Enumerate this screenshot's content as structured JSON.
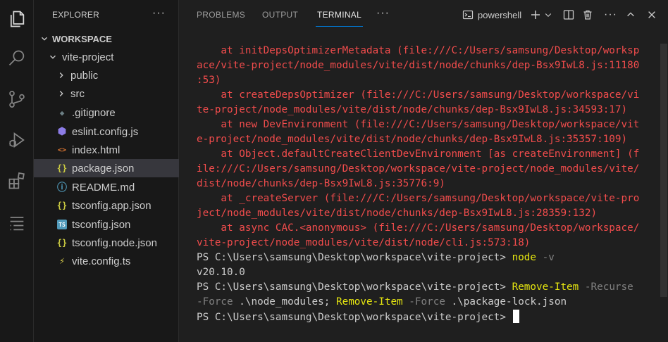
{
  "sidebar": {
    "title": "EXPLORER",
    "more": "···",
    "workspace": "WORKSPACE",
    "items": [
      {
        "label": "vite-project",
        "kind": "folder-open",
        "icon": "chevron-down-icon"
      },
      {
        "label": "public",
        "kind": "folder",
        "icon": "chevron-right-icon"
      },
      {
        "label": "src",
        "kind": "folder",
        "icon": "chevron-right-icon"
      },
      {
        "label": ".gitignore",
        "kind": "file",
        "icon": "gitignore-icon",
        "glyph": "◆",
        "color": "#6d8086"
      },
      {
        "label": "eslint.config.js",
        "kind": "file",
        "icon": "eslint-icon",
        "glyph": "⬢",
        "color": "#8c7ce6"
      },
      {
        "label": "index.html",
        "kind": "file",
        "icon": "html-icon",
        "glyph": "<>",
        "color": "#e37933"
      },
      {
        "label": "package.json",
        "kind": "file",
        "icon": "json-icon",
        "glyph": "{}",
        "color": "#cbcb41",
        "selected": true
      },
      {
        "label": "README.md",
        "kind": "file",
        "icon": "info-icon",
        "glyph": "ⓘ",
        "color": "#519aba"
      },
      {
        "label": "tsconfig.app.json",
        "kind": "file",
        "icon": "json-icon",
        "glyph": "{}",
        "color": "#cbcb41"
      },
      {
        "label": "tsconfig.json",
        "kind": "file",
        "icon": "typescript-icon",
        "glyph": "TS",
        "color": "#519aba"
      },
      {
        "label": "tsconfig.node.json",
        "kind": "file",
        "icon": "json-icon",
        "glyph": "{}",
        "color": "#cbcb41"
      },
      {
        "label": "vite.config.ts",
        "kind": "file",
        "icon": "vite-icon",
        "glyph": "⚡",
        "color": "#d4c84a"
      }
    ]
  },
  "panel": {
    "tabs": [
      "PROBLEMS",
      "OUTPUT",
      "TERMINAL"
    ],
    "active_tab": "TERMINAL",
    "more": "···",
    "shell_label": "powershell"
  },
  "terminal": {
    "lines": [
      [
        {
          "t": "    at initDepsOptimizerMetadata (file:///C:/Users/samsung/Desktop/worksp",
          "c": "err"
        }
      ],
      [
        {
          "t": "ace/vite-project/node_modules/vite/dist/node/chunks/dep-Bsx9IwL8.js:11180",
          "c": "err"
        }
      ],
      [
        {
          "t": ":53)",
          "c": "err"
        }
      ],
      [
        {
          "t": "    at createDepsOptimizer (file:///C:/Users/samsung/Desktop/workspace/vi",
          "c": "err"
        }
      ],
      [
        {
          "t": "te-project/node_modules/vite/dist/node/chunks/dep-Bsx9IwL8.js:34593:17)",
          "c": "err"
        }
      ],
      [
        {
          "t": "    at new DevEnvironment (file:///C:/Users/samsung/Desktop/workspace/vit",
          "c": "err"
        }
      ],
      [
        {
          "t": "e-project/node_modules/vite/dist/node/chunks/dep-Bsx9IwL8.js:35357:109)",
          "c": "err"
        }
      ],
      [
        {
          "t": "    at Object.defaultCreateClientDevEnvironment [as createEnvironment] (f",
          "c": "err"
        }
      ],
      [
        {
          "t": "ile:///C:/Users/samsung/Desktop/workspace/vite-project/node_modules/vite/",
          "c": "err"
        }
      ],
      [
        {
          "t": "dist/node/chunks/dep-Bsx9IwL8.js:35776:9)",
          "c": "err"
        }
      ],
      [
        {
          "t": "    at _createServer (file:///C:/Users/samsung/Desktop/workspace/vite-pro",
          "c": "err"
        }
      ],
      [
        {
          "t": "ject/node_modules/vite/dist/node/chunks/dep-Bsx9IwL8.js:28359:132)",
          "c": "err"
        }
      ],
      [
        {
          "t": "    at async CAC.<anonymous> (file:///C:/Users/samsung/Desktop/workspace/",
          "c": "err"
        }
      ],
      [
        {
          "t": "vite-project/node_modules/vite/dist/node/cli.js:573:18)",
          "c": "err"
        }
      ],
      [
        {
          "t": "PS C:\\Users\\samsung\\Desktop\\workspace\\vite-project> ",
          "c": "out"
        },
        {
          "t": "node",
          "c": "cmd"
        },
        {
          "t": " -v",
          "c": "arg"
        }
      ],
      [
        {
          "t": "v20.10.0",
          "c": "out"
        }
      ],
      [
        {
          "t": "PS C:\\Users\\samsung\\Desktop\\workspace\\vite-project> ",
          "c": "out"
        },
        {
          "t": "Remove-Item",
          "c": "cmd"
        },
        {
          "t": " -Recurse",
          "c": "arg"
        }
      ],
      [
        {
          "t": "-Force",
          "c": "arg"
        },
        {
          "t": " .\\node_modules; ",
          "c": "out"
        },
        {
          "t": "Remove-Item",
          "c": "cmd"
        },
        {
          "t": " -Force",
          "c": "arg"
        },
        {
          "t": " .\\package-lock.json",
          "c": "out"
        }
      ],
      [
        {
          "t": "PS C:\\Users\\samsung\\Desktop\\workspace\\vite-project> ",
          "c": "out"
        }
      ]
    ]
  },
  "colors": {
    "error": "#f14c4c",
    "command": "#e5e510",
    "argument": "#808080",
    "accent": "#0078d4"
  }
}
